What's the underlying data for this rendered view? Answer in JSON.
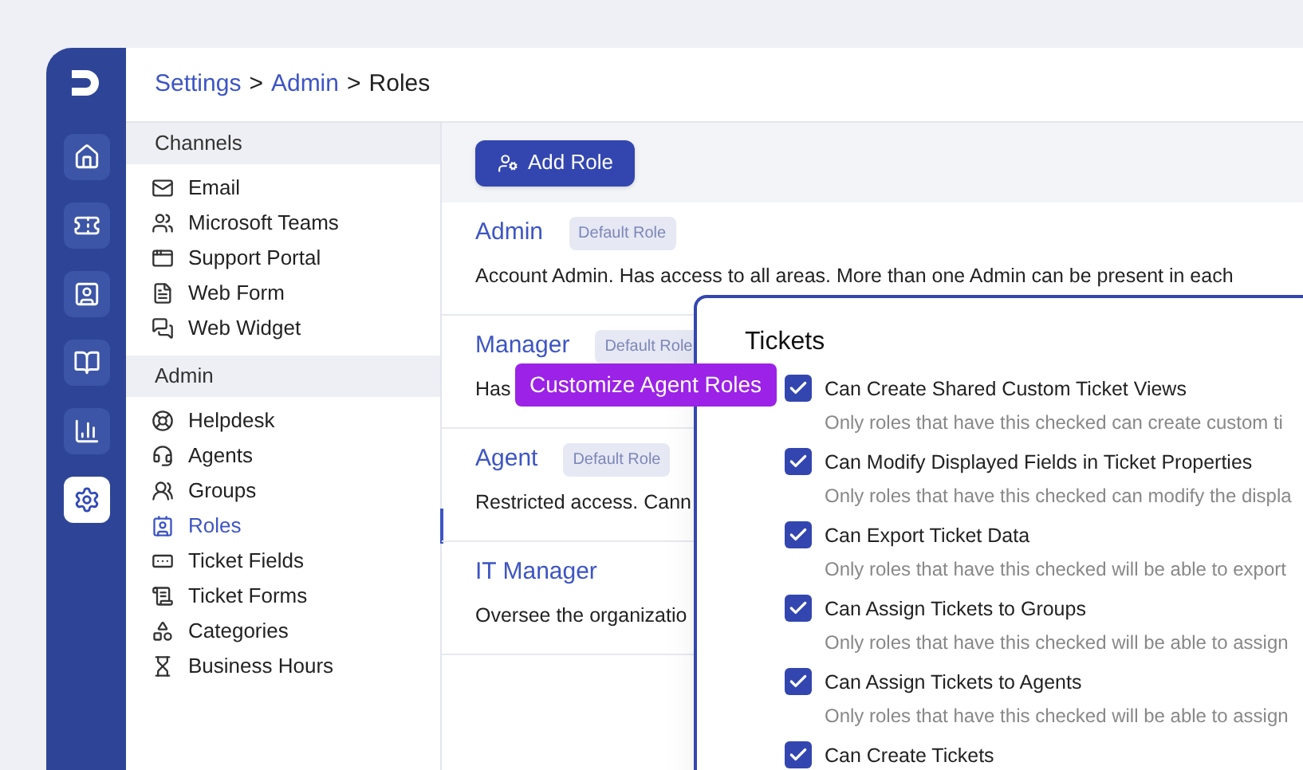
{
  "rail": {
    "items": [
      {
        "selected": false
      },
      {
        "selected": false
      },
      {
        "selected": false
      },
      {
        "selected": false
      },
      {
        "selected": false
      },
      {
        "selected": true
      }
    ]
  },
  "breadcrumb": [
    {
      "label": "Settings",
      "kind": "link"
    },
    {
      "label": ">",
      "kind": "separator"
    },
    {
      "label": "Admin",
      "kind": "link"
    },
    {
      "label": ">",
      "kind": "separator"
    },
    {
      "label": "Roles",
      "kind": "current"
    }
  ],
  "nav": [
    {
      "heading": "Channels",
      "items": [
        {
          "label": "Email",
          "selected": false
        },
        {
          "label": "Microsoft Teams",
          "selected": false
        },
        {
          "label": "Support Portal",
          "selected": false
        },
        {
          "label": "Web Form",
          "selected": false
        },
        {
          "label": "Web Widget",
          "selected": false
        }
      ]
    },
    {
      "heading": "Admin",
      "items": [
        {
          "label": "Helpdesk",
          "selected": false
        },
        {
          "label": "Agents",
          "selected": false
        },
        {
          "label": "Groups",
          "selected": false
        },
        {
          "label": "Roles",
          "selected": true
        },
        {
          "label": "Ticket Fields",
          "selected": false
        },
        {
          "label": "Ticket Forms",
          "selected": false
        },
        {
          "label": "Categories",
          "selected": false
        },
        {
          "label": "Business Hours",
          "selected": false
        }
      ]
    }
  ],
  "add_button": "Add Role",
  "roles": [
    {
      "name": "Admin",
      "badge": "Default Role",
      "description": "Account Admin. Has access to all areas. More than one Admin can be present in each"
    },
    {
      "name": "Manager",
      "badge": "Default Role",
      "description": "Has"
    },
    {
      "name": "Agent",
      "badge": "Default Role",
      "description": "Restricted access. Cann"
    },
    {
      "name": "IT Manager",
      "description": "Oversee the organizatio"
    }
  ],
  "callout": "Customize Agent Roles",
  "panel": {
    "title": "Tickets",
    "items": [
      {
        "label": "Can Create Shared Custom Ticket Views",
        "description": "Only roles that have this checked can create custom ti",
        "checked": true
      },
      {
        "label": "Can Modify Displayed Fields in Ticket Properties",
        "description": "Only roles that have this checked can modify the displa",
        "checked": true
      },
      {
        "label": "Can Export Ticket Data",
        "description": "Only roles that have this checked will be able to export",
        "checked": true
      },
      {
        "label": "Can Assign Tickets to Groups",
        "description": "Only roles that have this checked will be able to assign",
        "checked": true
      },
      {
        "label": "Can Assign Tickets to Agents",
        "description": "Only roles that have this checked will be able to assign",
        "checked": true
      },
      {
        "label": "Can Create Tickets",
        "checked": true
      }
    ]
  }
}
